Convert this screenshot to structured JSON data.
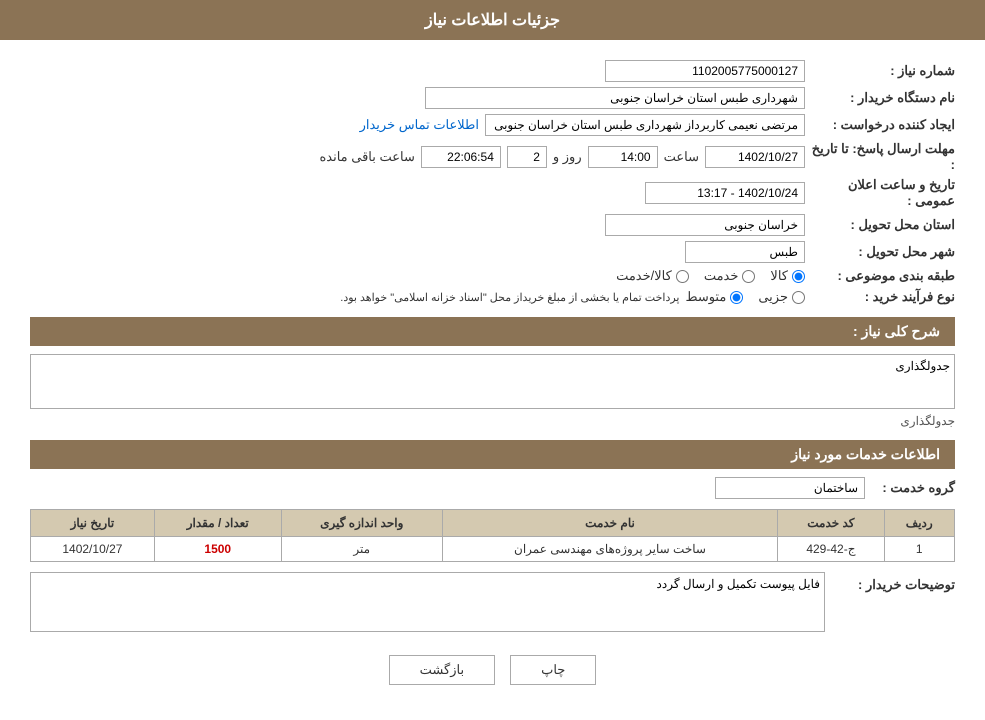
{
  "header": {
    "title": "جزئیات اطلاعات نیاز"
  },
  "fields": {
    "shomareNiaz_label": "شماره نیاز :",
    "shomareNiaz_value": "1102005775000127",
    "namDastgah_label": "نام دستگاه خریدار :",
    "namDastgah_value": "شهرداری طبس استان خراسان جنوبی",
    "eijadKonande_label": "ایجاد کننده درخواست :",
    "eijadKonande_value": "مرتضی نعیمی کاربرداز شهرداری طبس استان خراسان جنوبی",
    "ettelaat_link": "اطلاعات تماس خریدار",
    "mohlat_label": "مهلت ارسال پاسخ: تا تاریخ :",
    "mohlat_date": "1402/10/27",
    "mohlat_saat_label": "ساعت",
    "mohlat_saat": "14:00",
    "mohlat_rooz_label": "روز و",
    "mohlat_rooz_count": "2",
    "mohlat_remaining": "22:06:54",
    "mohlat_remaining_label": "ساعت باقی مانده",
    "ostan_label": "استان محل تحویل :",
    "ostan_value": "خراسان جنوبی",
    "shahr_label": "شهر محل تحویل :",
    "shahr_value": "طبس",
    "tabaqe_label": "طبقه بندی موضوعی :",
    "tabaqe_options": [
      {
        "label": "کالا",
        "selected": true
      },
      {
        "label": "خدمت",
        "selected": false
      },
      {
        "label": "کالا/خدمت",
        "selected": false
      }
    ],
    "noefarayand_label": "نوع فرآیند خرید :",
    "noefarayand_options": [
      {
        "label": "جزیی",
        "selected": false
      },
      {
        "label": "متوسط",
        "selected": true
      }
    ],
    "noefarayand_desc": "پرداخت تمام یا بخشی از مبلغ خریداز محل \"اسناد خزانه اسلامی\" خواهد بود.",
    "taarikh_elaan_label": "تاریخ و ساعت اعلان عمومی :",
    "taarikh_elaan_value": "1402/10/24 - 13:17"
  },
  "sharh": {
    "section_title": "شرح کلی نیاز :",
    "value": "جدولگذاری"
  },
  "services": {
    "section_title": "اطلاعات خدمات مورد نیاز",
    "group_label": "گروه خدمت :",
    "group_value": "ساختمان",
    "table": {
      "headers": [
        "ردیف",
        "کد خدمت",
        "نام خدمت",
        "واحد اندازه گیری",
        "تعداد / مقدار",
        "تاریخ نیاز"
      ],
      "rows": [
        {
          "radif": "1",
          "kod": "ج-42-429",
          "nam": "ساخت سایر پروژه‌های مهندسی عمران",
          "vahed": "متر",
          "tedad": "1500",
          "tarikh": "1402/10/27"
        }
      ]
    }
  },
  "buyer_desc": {
    "label": "توضیحات خریدار :",
    "value": "فایل پیوست تکمیل و ارسال گردد"
  },
  "buttons": {
    "print": "چاپ",
    "back": "بازگشت"
  }
}
